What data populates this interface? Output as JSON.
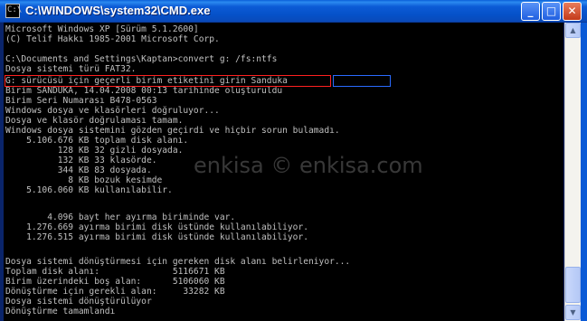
{
  "window": {
    "title": "C:\\WINDOWS\\system32\\CMD.exe",
    "icon": "cmd-icon",
    "icon_glyph": "C:\\",
    "minimize_glyph": "_",
    "maximize_glyph": "□",
    "close_glyph": "✕"
  },
  "console": {
    "lines": [
      "Microsoft Windows XP [Sürüm 5.1.2600]",
      "(C) Telif Hakkı 1985-2001 Microsoft Corp.",
      "",
      "C:\\Documents and Settings\\Kaptan>convert g: /fs:ntfs",
      "Dosya sistemi türü FAT32.",
      "G: sürücüsü için geçerli birim etiketini girin Sanduka",
      "Birim SANDUKA, 14.04.2008 00:13 tarihinde oluşturuldu",
      "Birim Seri Numarası B478-0563",
      "Windows dosya ve klasörleri doğruluyor...",
      "Dosya ve klasör doğrulaması tamam.",
      "Windows dosya sistemini gözden geçirdi ve hiçbir sorun bulamadı.",
      "    5.106.676 KB toplam disk alanı.",
      "          128 KB 32 gizli dosyada.",
      "          132 KB 33 klasörde.",
      "          344 KB 83 dosyada.",
      "            8 KB bozuk kesimde",
      "    5.106.060 KB kullanılabilir.",
      "",
      "        4.096 bayt her ayırma biriminde var.",
      "    1.276.669 ayırma birimi disk üstünde kullanılabiliyor.",
      "    1.276.515 ayırma birimi disk üstünde kullanılabiliyor.",
      "",
      "Dosya sistemi dönüştürmesi için gereken disk alanı belirleniyor...",
      "Toplam disk alanı:              5116671 KB",
      "Birim üzerindeki boş alan:      5106060 KB",
      "Dönüştürme için gerekli alan:     33282 KB",
      "Dosya sistemi dönüştürülüyor",
      "Dönüştürme tamamlandı"
    ]
  },
  "watermark": "enkisa © enkisa.com",
  "scrollbar": {
    "up_glyph": "▲",
    "down_glyph": "▼"
  }
}
